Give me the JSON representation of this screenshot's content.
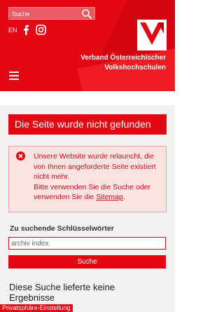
{
  "header": {
    "search_placeholder": "Suche",
    "language": "EN",
    "org_name_line1": "Verband Österreichischer",
    "org_name_line2": "Volkshochschulen",
    "brand_color": "#e30613"
  },
  "main": {
    "title": "Die Seite wurde nicht gefunden",
    "alert": {
      "line1": "Unsere Website wurde relauncht, die von Ihnen angeforderte Seite existiert nicht mehr.",
      "line2_prefix": "Bitte verwenden Sie die Suche oder verwenden Sie die ",
      "sitemap_link": "Sitemap",
      "line2_suffix": "."
    },
    "keywords_label": "Zu suchende Schlüsselwörter",
    "keywords_value": "archiv index",
    "search_button": "Suche",
    "no_results": "Diese Suche lieferte keine Ergebnisse"
  },
  "footer": {
    "privacy_button": "Privatsphäre-Einstellung"
  },
  "icons": [
    "search-icon",
    "facebook-icon",
    "instagram-icon",
    "menu-icon",
    "error-icon",
    "logo"
  ]
}
